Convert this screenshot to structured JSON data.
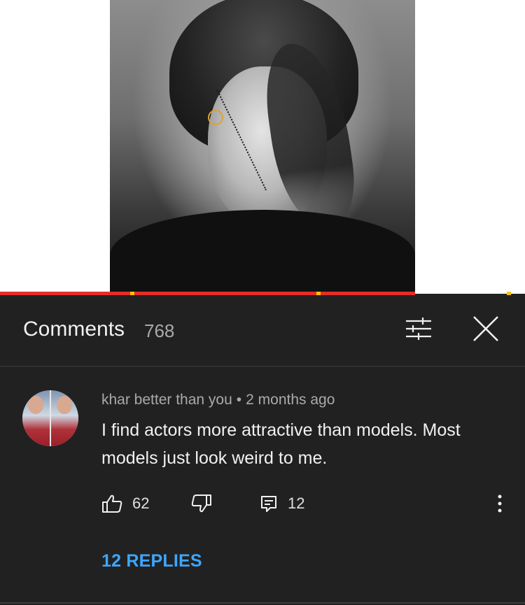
{
  "header": {
    "title": "Comments",
    "count": "768"
  },
  "comment": {
    "author": "khar better than you",
    "separator": "•",
    "time": "2 months ago",
    "text": "I find actors more attractive than models. Most models just look weird to me.",
    "likes": "62",
    "replies_count": "12",
    "replies_link": "12 REPLIES"
  },
  "icons": {
    "filter": "sliders-icon",
    "close": "close-icon",
    "like": "thumbs-up-icon",
    "dislike": "thumbs-down-icon",
    "reply": "reply-icon",
    "more": "more-vertical-icon"
  },
  "colors": {
    "panel_bg": "#212121",
    "link_blue": "#3ea6ff",
    "progress_red": "#e52d27",
    "marker_yellow": "#f5c400"
  }
}
